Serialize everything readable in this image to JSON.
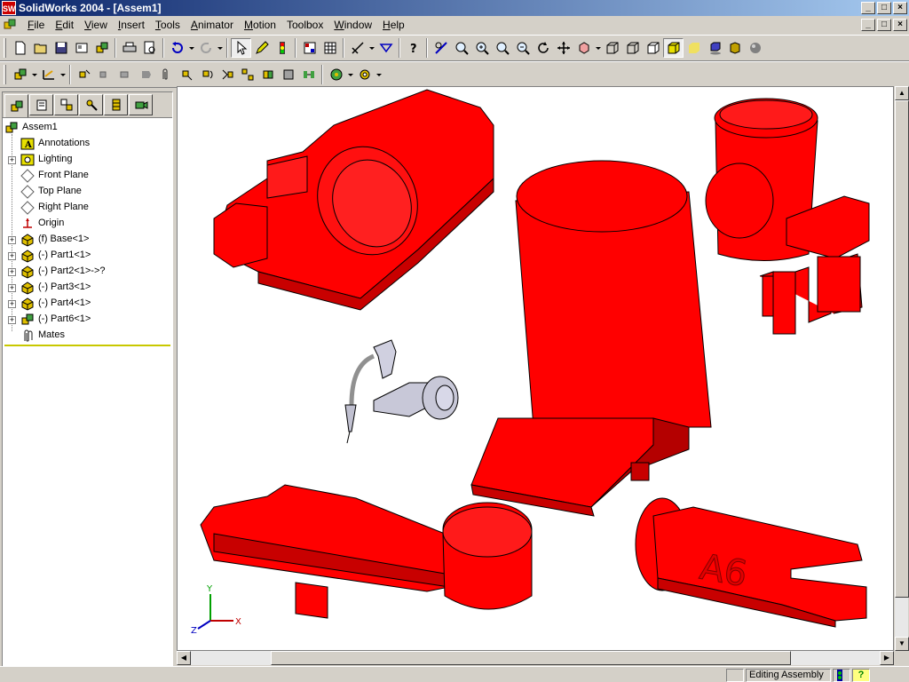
{
  "app": {
    "title": "SolidWorks 2004 - [Assem1]",
    "icon_label": "SW"
  },
  "menu": {
    "items": [
      {
        "first": "F",
        "rest": "ile"
      },
      {
        "first": "E",
        "rest": "dit"
      },
      {
        "first": "V",
        "rest": "iew"
      },
      {
        "first": "I",
        "rest": "nsert"
      },
      {
        "first": "T",
        "rest": "ools"
      },
      {
        "first": "A",
        "rest": "nimator"
      },
      {
        "first": "M",
        "rest": "otion"
      },
      {
        "first": "",
        "rest": "Toolbox"
      },
      {
        "first": "W",
        "rest": "indow"
      },
      {
        "first": "H",
        "rest": "elp"
      }
    ]
  },
  "window_controls": {
    "minimize": "_",
    "maximize": "□",
    "close": "×"
  },
  "tree": {
    "root": "Assem1",
    "items": [
      {
        "label": "Annotations",
        "icon": "annotation-icon",
        "expander": false
      },
      {
        "label": "Lighting",
        "icon": "lighting-icon",
        "expander": true
      },
      {
        "label": "Front Plane",
        "icon": "plane-icon",
        "expander": false
      },
      {
        "label": "Top Plane",
        "icon": "plane-icon",
        "expander": false
      },
      {
        "label": "Right Plane",
        "icon": "plane-icon",
        "expander": false
      },
      {
        "label": "Origin",
        "icon": "origin-icon",
        "expander": false
      },
      {
        "label": "(f) Base<1>",
        "icon": "part-icon",
        "expander": true
      },
      {
        "label": "(-) Part1<1>",
        "icon": "part-icon",
        "expander": true
      },
      {
        "label": "(-) Part2<1>->?",
        "icon": "part-icon",
        "expander": true
      },
      {
        "label": "(-) Part3<1>",
        "icon": "part-icon",
        "expander": true
      },
      {
        "label": "(-) Part4<1>",
        "icon": "part-icon",
        "expander": true
      },
      {
        "label": "(-) Part6<1>",
        "icon": "part-icon",
        "expander": true
      },
      {
        "label": "Mates",
        "icon": "mates-icon",
        "expander": false
      }
    ],
    "expander_symbol": "+"
  },
  "viewport": {
    "engraving": "A6",
    "triad": {
      "x": "X",
      "y": "Y",
      "z": "Z"
    }
  },
  "status": {
    "mode": "Editing Assembly",
    "help": "?"
  },
  "colors": {
    "part_red": "#ff0000",
    "part_shadow": "#c80000",
    "part_dark": "#960000",
    "part_light": "#ff5050",
    "title_start": "#0a246a",
    "title_end": "#a6caf0"
  }
}
